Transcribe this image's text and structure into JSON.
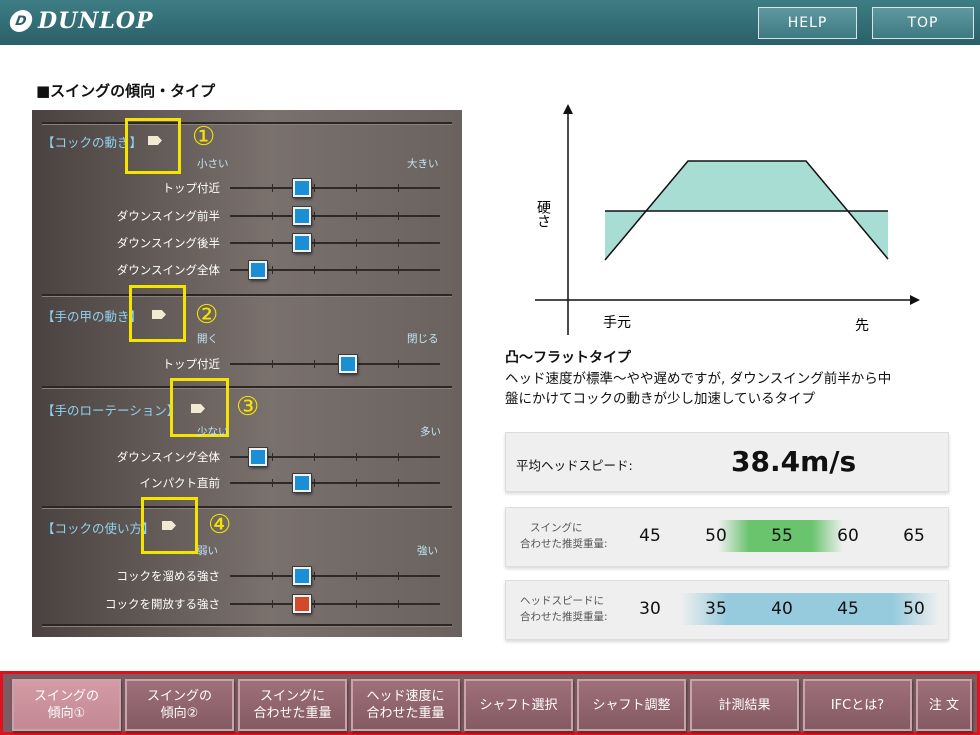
{
  "header": {
    "brand": "DUNLOP",
    "brand_mark": "D",
    "help_label": "HELP",
    "top_label": "TOP"
  },
  "section_title": "■スイングの傾向・タイプ",
  "groups": [
    {
      "label": "【コックの動き】",
      "badge": "①",
      "scale_left": "小さい",
      "scale_right": "大きい",
      "rows": [
        {
          "label": "トップ付近",
          "value": 0.33
        },
        {
          "label": "ダウンスイング前半",
          "value": 0.33
        },
        {
          "label": "ダウンスイング後半",
          "value": 0.33
        },
        {
          "label": "ダウンスイング全体",
          "value": 0.1
        }
      ]
    },
    {
      "label": "【手の甲の動き】",
      "badge": "②",
      "scale_left": "開く",
      "scale_right": "閉じる",
      "rows": [
        {
          "label": "トップ付近",
          "value": 0.57
        }
      ]
    },
    {
      "label": "【手のローテーション】",
      "badge": "③",
      "scale_left": "少ない",
      "scale_right": "多い",
      "rows": [
        {
          "label": "ダウンスイング全体",
          "value": 0.1
        },
        {
          "label": "インパクト直前",
          "value": 0.33
        }
      ]
    },
    {
      "label": "【コックの使い方】",
      "badge": "④",
      "scale_left": "弱い",
      "scale_right": "強い",
      "rows": [
        {
          "label": "コックを溜める強さ",
          "value": 0.33
        },
        {
          "label": "コックを開放する強さ",
          "value": 0.33,
          "color": "red"
        }
      ]
    }
  ],
  "graph": {
    "y_label": "硬さ",
    "x_label_left": "手元",
    "x_label_right": "先"
  },
  "type": {
    "title": "凸〜フラットタイプ",
    "description_line1": "ヘッド速度が標準〜やや遅めですが, ダウンスイング前半から中",
    "description_line2": "盤にかけてコックの動きが少し加速しているタイプ"
  },
  "speed": {
    "label": "平均ヘッドスピード:",
    "value": "38.4m/s"
  },
  "weight_swing": {
    "label_line1": "スイングに",
    "label_line2": "合わせた推奨重量:",
    "values": [
      "45",
      "50",
      "55",
      "60",
      "65"
    ],
    "highlight": "55"
  },
  "weight_head": {
    "label_line1": "ヘッドスピードに",
    "label_line2": "合わせた推奨重量:",
    "values": [
      "30",
      "35",
      "40",
      "45",
      "50"
    ],
    "highlight_range": [
      "35",
      "45"
    ]
  },
  "nav": [
    {
      "label": "スイングの\n傾向①",
      "active": true
    },
    {
      "label": "スイングの\n傾向②"
    },
    {
      "label": "スイングに\n合わせた重量"
    },
    {
      "label": "ヘッド速度に\n合わせた重量"
    },
    {
      "label": "シャフト選択"
    },
    {
      "label": "シャフト調整"
    },
    {
      "label": "計測結果"
    },
    {
      "label": "IFCとは?"
    },
    {
      "label": "注 文"
    }
  ],
  "colors": {
    "header": "#2a6068",
    "nav": "#855a63",
    "highlight_box": "#f4e400",
    "graph_fill": "#a8ddd4"
  }
}
